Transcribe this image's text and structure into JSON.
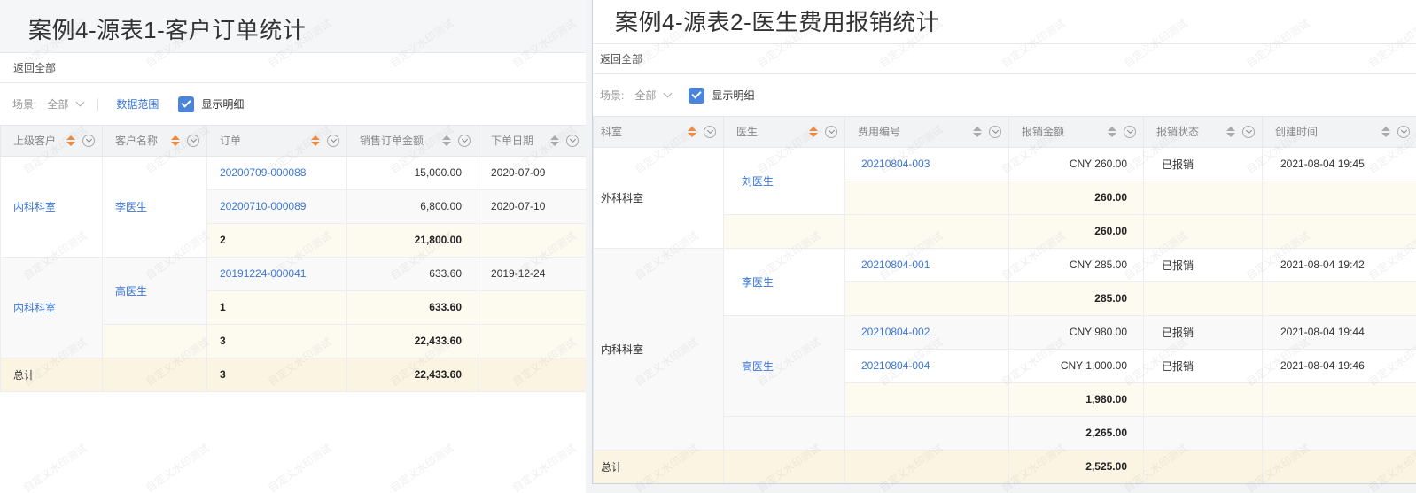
{
  "left": {
    "title": "案例4-源表1-客户订单统计",
    "back": "返回全部",
    "scene_label": "场景:",
    "scene_value": "全部",
    "data_range": "数据范围",
    "show_detail": "显示明细",
    "columns": [
      "上级客户",
      "客户名称",
      "订单",
      "销售订单金额",
      "下单日期"
    ],
    "rows": [
      {
        "order": "20200709-000088",
        "amount": "15,000.00",
        "date": "2020-07-09"
      },
      {
        "order": "20200710-000089",
        "amount": "6,800.00",
        "date": "2020-07-10"
      },
      {
        "order": "2",
        "amount": "21,800.00"
      },
      {
        "order": "20191224-000041",
        "amount": "633.60",
        "date": "2019-12-24"
      },
      {
        "order": "1",
        "amount": "633.60"
      },
      {
        "order": "3",
        "amount": "22,433.60"
      }
    ],
    "groups": [
      {
        "parent": "内科科室",
        "customer": "李医生"
      },
      {
        "parent": "内科科室",
        "customer": "高医生"
      }
    ],
    "total": {
      "label": "总计",
      "count": "3",
      "amount": "22,433.60"
    }
  },
  "right": {
    "title": "案例4-源表2-医生费用报销统计",
    "back": "返回全部",
    "scene_label": "场景:",
    "scene_value": "全部",
    "show_detail": "显示明细",
    "columns": [
      "科室",
      "医生",
      "费用编号",
      "报销金额",
      "报销状态",
      "创建时间"
    ],
    "depts": [
      "外科科室",
      "内科科室"
    ],
    "doctors": [
      "刘医生",
      "李医生",
      "高医生"
    ],
    "rows": [
      {
        "code": "20210804-003",
        "amount": "CNY 260.00",
        "status": "已报销",
        "time": "2021-08-04 19:45"
      },
      {
        "amount": "260.00"
      },
      {
        "amount": "260.00"
      },
      {
        "code": "20210804-001",
        "amount": "CNY 285.00",
        "status": "已报销",
        "time": "2021-08-04 19:42"
      },
      {
        "amount": "285.00"
      },
      {
        "code": "20210804-002",
        "amount": "CNY 980.00",
        "status": "已报销",
        "time": "2021-08-04 19:44"
      },
      {
        "code": "20210804-004",
        "amount": "CNY 1,000.00",
        "status": "已报销",
        "time": "2021-08-04 19:46"
      },
      {
        "amount": "1,980.00"
      },
      {
        "amount": "2,265.00"
      }
    ],
    "total": {
      "label": "总计",
      "amount": "2,525.00"
    }
  },
  "watermark": "自定义水印测试",
  "colors": {
    "link": "#3a76d8",
    "sort_active": "#f0883a",
    "checkbox": "#4b84db",
    "subtotal_bg": "#fdfaf0",
    "total_bg": "#fcf4e3"
  }
}
